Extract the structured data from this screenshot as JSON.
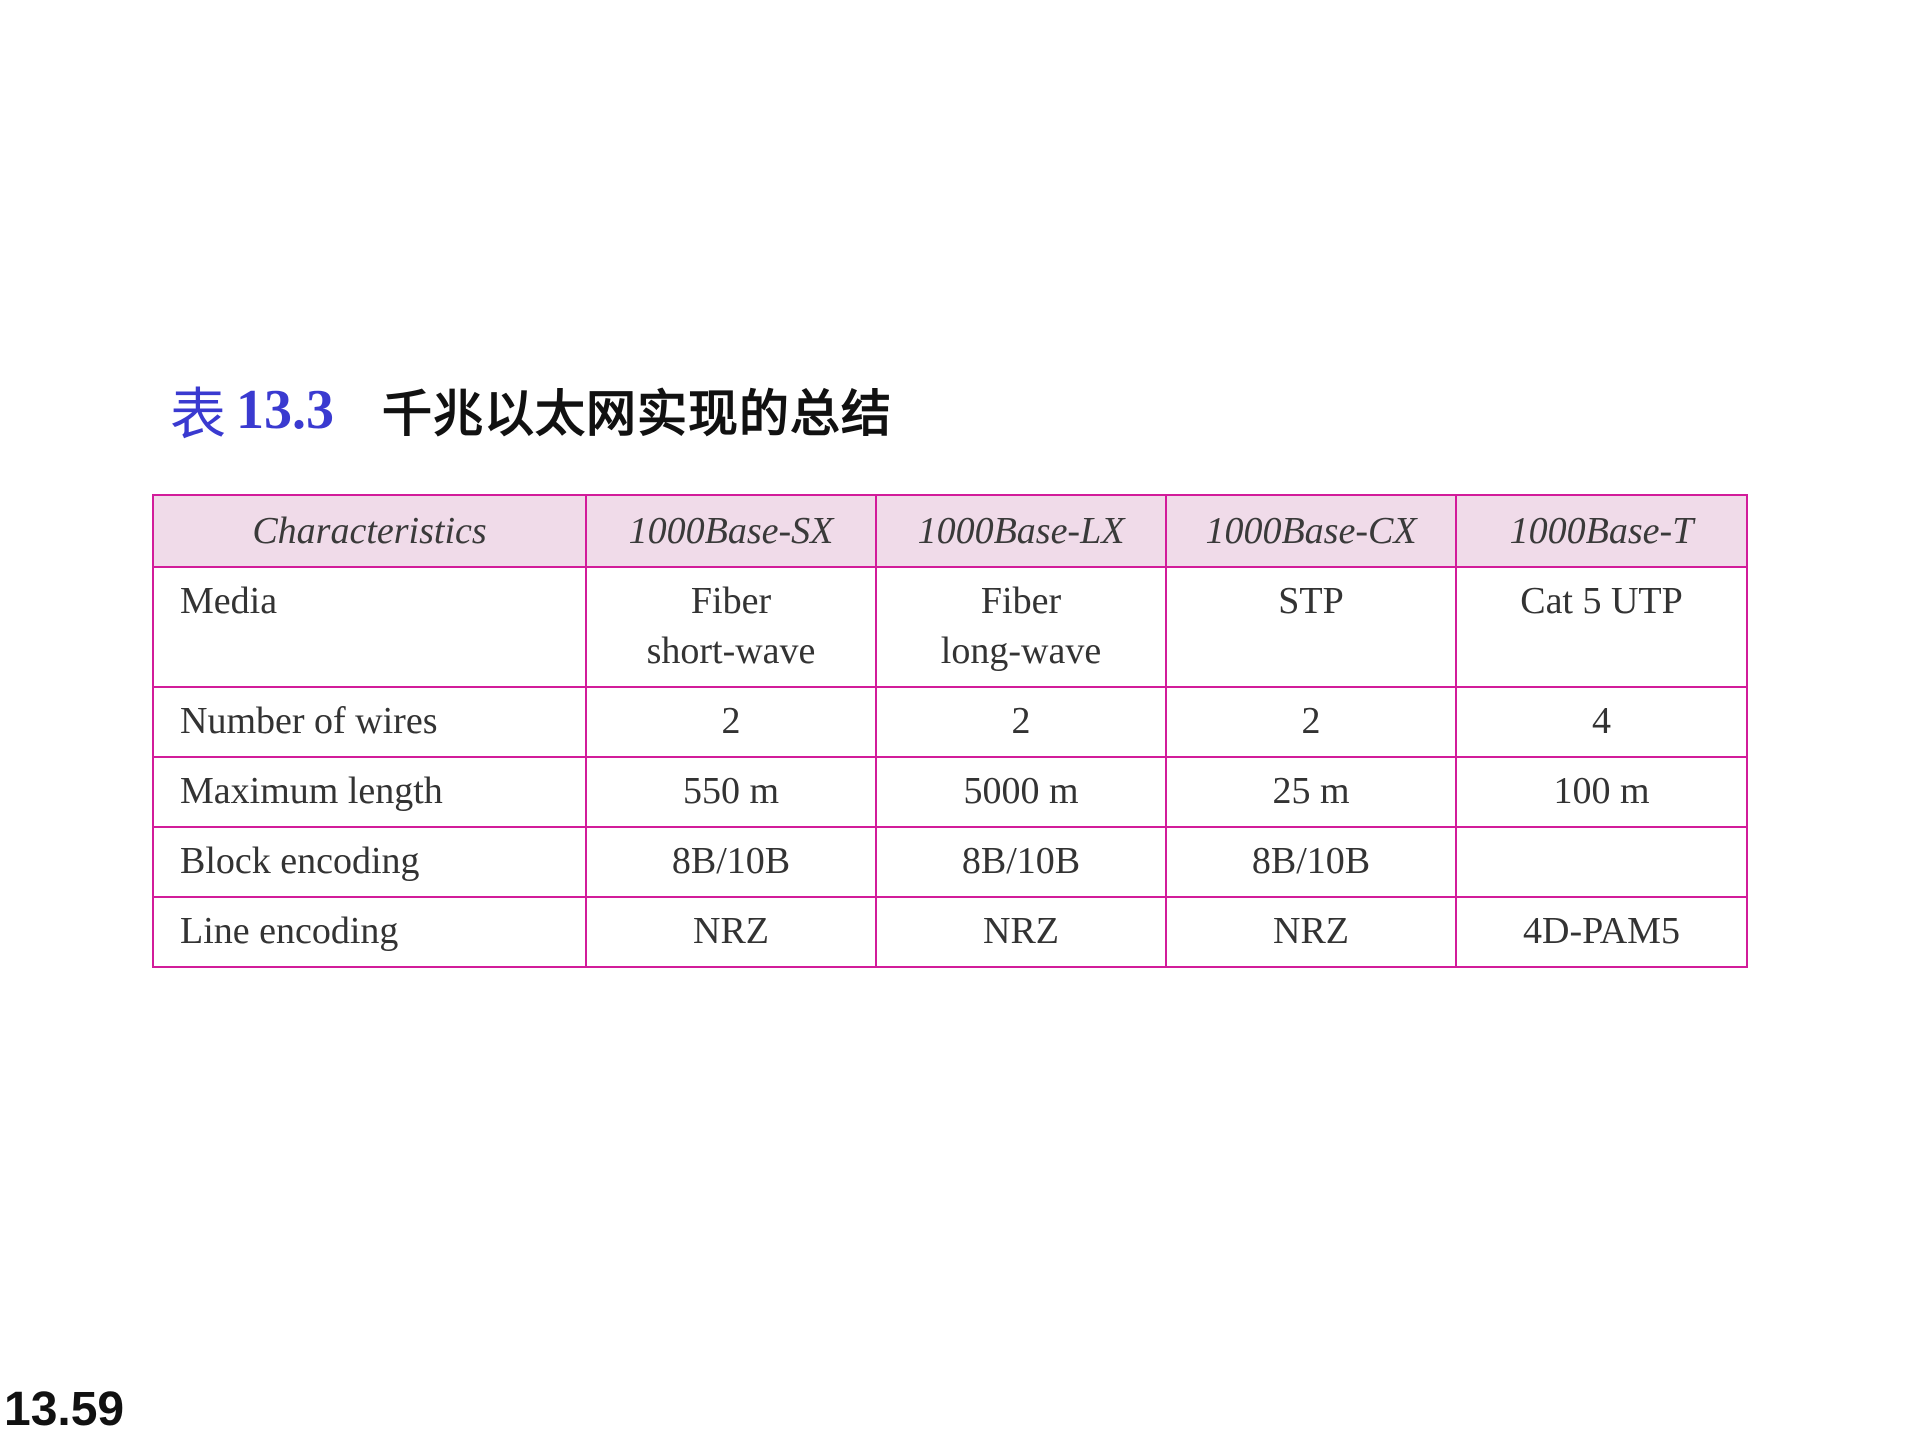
{
  "title": {
    "prefix": "表",
    "number": "13.3",
    "text": "千兆以太网实现的总结"
  },
  "table": {
    "headers": [
      "Characteristics",
      "1000Base-SX",
      "1000Base-LX",
      "1000Base-CX",
      "1000Base-T"
    ],
    "rows": [
      {
        "label": "Media",
        "cells": [
          [
            "Fiber",
            "short-wave"
          ],
          [
            "Fiber",
            "long-wave"
          ],
          [
            "STP"
          ],
          [
            "Cat 5 UTP"
          ]
        ]
      },
      {
        "label": "Number of wires",
        "cells": [
          [
            "2"
          ],
          [
            "2"
          ],
          [
            "2"
          ],
          [
            "4"
          ]
        ]
      },
      {
        "label": "Maximum length",
        "cells": [
          [
            "550 m"
          ],
          [
            "5000 m"
          ],
          [
            "25 m"
          ],
          [
            "100 m"
          ]
        ]
      },
      {
        "label": "Block encoding",
        "cells": [
          [
            "8B/10B"
          ],
          [
            "8B/10B"
          ],
          [
            "8B/10B"
          ],
          [
            ""
          ]
        ]
      },
      {
        "label": "Line encoding",
        "cells": [
          [
            "NRZ"
          ],
          [
            "NRZ"
          ],
          [
            "NRZ"
          ],
          [
            "4D-PAM5"
          ]
        ]
      }
    ],
    "colors": {
      "border": "#d21c9a",
      "header_bg": "#f0dbe9",
      "title_accent": "#3a3ad0"
    }
  },
  "page_number": "13.59"
}
